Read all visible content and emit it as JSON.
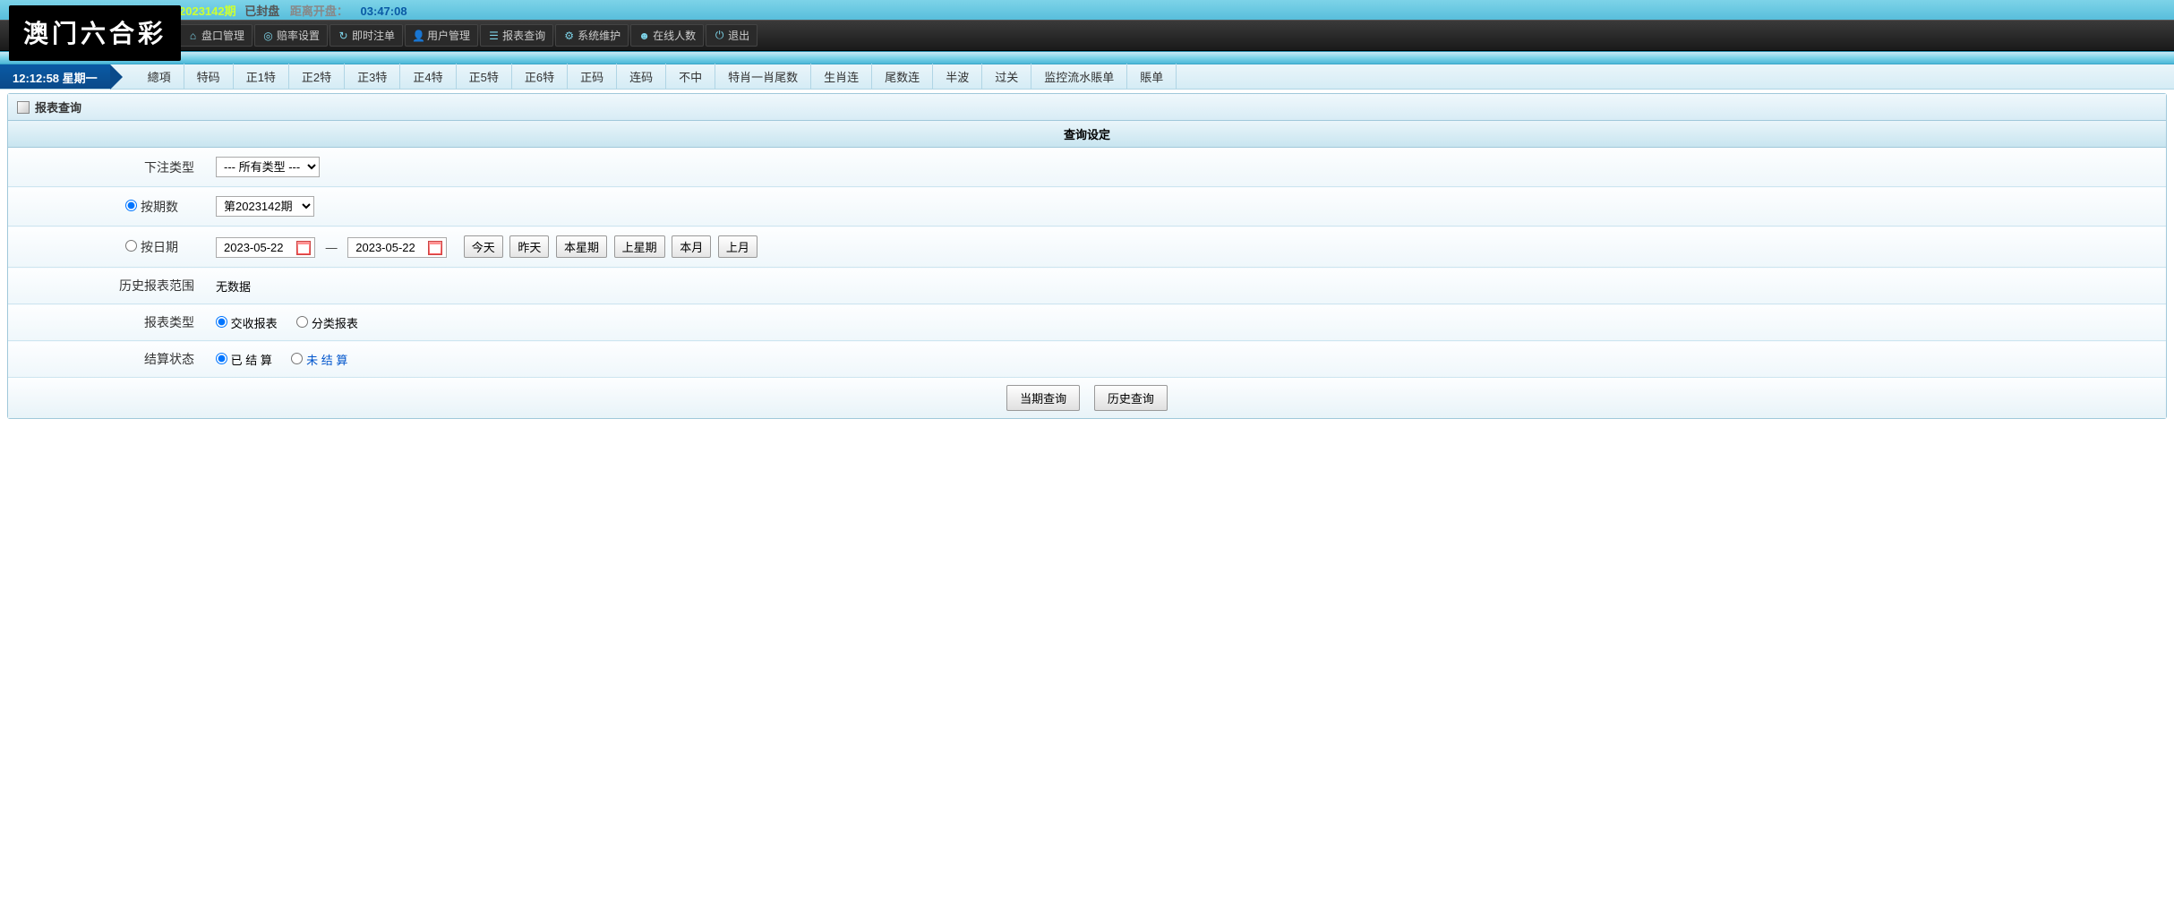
{
  "logo": "澳门六合彩",
  "status": {
    "period": "2023142期",
    "sealed": "已封盘",
    "opening_label": "距离开盘：",
    "opening_time": "03:47:08"
  },
  "nav": [
    {
      "icon": "home",
      "label": "盘口管理"
    },
    {
      "icon": "target",
      "label": "赔率设置"
    },
    {
      "icon": "refresh",
      "label": "即时注单"
    },
    {
      "icon": "user",
      "label": "用户管理"
    },
    {
      "icon": "list",
      "label": "报表查询"
    },
    {
      "icon": "gear",
      "label": "系统维护"
    },
    {
      "icon": "people",
      "label": "在线人数"
    },
    {
      "icon": "power",
      "label": "退出"
    }
  ],
  "time_tab": "12:12:58 星期一",
  "tabs": [
    "總項",
    "特码",
    "正1特",
    "正2特",
    "正3特",
    "正4特",
    "正5特",
    "正6特",
    "正码",
    "连码",
    "不中",
    "特肖一肖尾数",
    "生肖连",
    "尾数连",
    "半波",
    "过关",
    "监控流水賬单",
    "賬单"
  ],
  "panel_title": "报表查询",
  "query_settings_title": "查询设定",
  "form": {
    "bet_type_label": "下注类型",
    "bet_type_value": "--- 所有类型 ---",
    "by_period_label": "按期数",
    "period_value": "第2023142期",
    "by_date_label": "按日期",
    "date_from": "2023-05-22",
    "date_to": "2023-05-22",
    "date_buttons": [
      "今天",
      "昨天",
      "本星期",
      "上星期",
      "本月",
      "上月"
    ],
    "history_range_label": "历史报表范围",
    "history_range_value": "无数据",
    "report_type_label": "报表类型",
    "report_type_options": [
      "交收报表",
      "分类报表"
    ],
    "settle_status_label": "结算状态",
    "settle_options": {
      "settled": "已 结 算",
      "unsettled": "未 结 算"
    }
  },
  "buttons": {
    "current": "当期查询",
    "history": "历史查询"
  }
}
